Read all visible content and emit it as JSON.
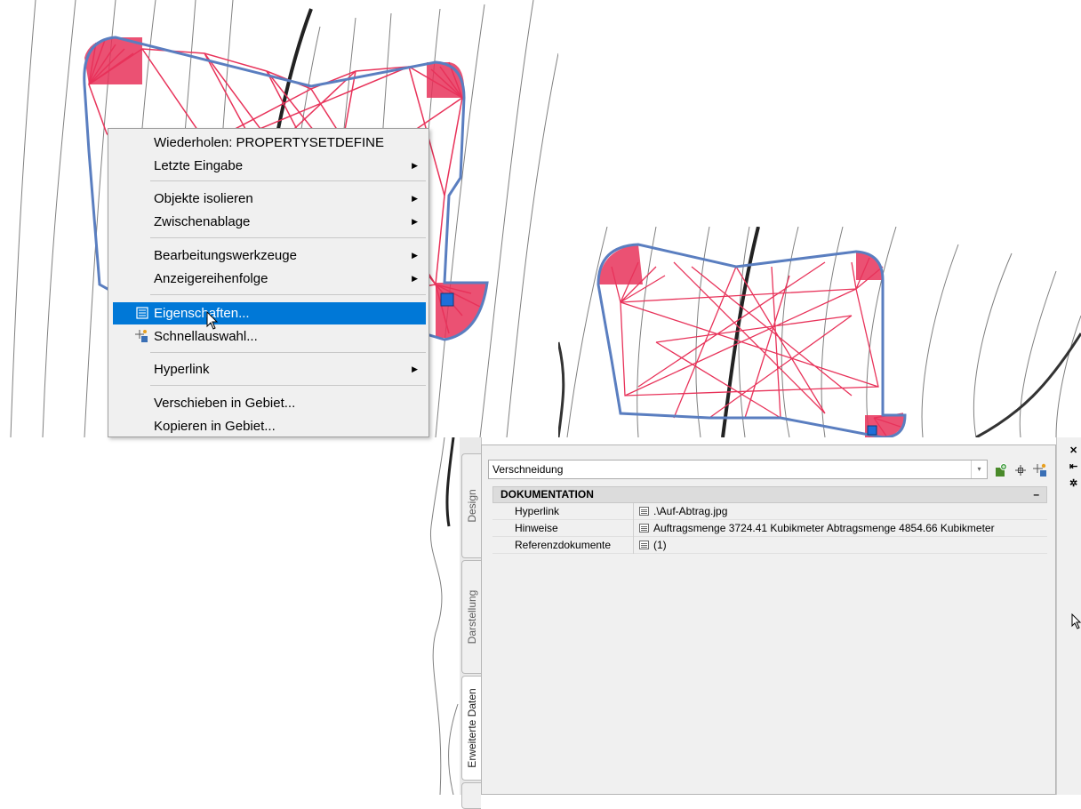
{
  "context_menu": {
    "items": [
      {
        "label": "Wiederholen: PROPERTYSETDEFINE",
        "submenu": false
      },
      {
        "label": "Letzte Eingabe",
        "submenu": true
      },
      {
        "label": "Objekte isolieren",
        "submenu": true
      },
      {
        "label": "Zwischenablage",
        "submenu": true
      },
      {
        "label": "Bearbeitungswerkzeuge",
        "submenu": true
      },
      {
        "label": "Anzeigereihenfolge",
        "submenu": true
      },
      {
        "label": "Eigenschaften...",
        "submenu": false,
        "selected": true,
        "icon": "properties-icon"
      },
      {
        "label": "Schnellauswahl...",
        "submenu": false,
        "icon": "quick-select-icon"
      },
      {
        "label": "Hyperlink",
        "submenu": true
      },
      {
        "label": "Verschieben in Gebiet...",
        "submenu": false
      },
      {
        "label": "Kopieren in Gebiet...",
        "submenu": false
      }
    ],
    "submenu_arrow": "▶"
  },
  "properties_palette": {
    "object_type": "Verschneidung",
    "dropdown_glyph": "▾",
    "tabs": [
      {
        "label": "Design",
        "active": false
      },
      {
        "label": "Darstellung",
        "active": false
      },
      {
        "label": "Erweiterte Daten",
        "active": true
      }
    ],
    "section": {
      "title": "DOKUMENTATION",
      "collapse_glyph": "–"
    },
    "rows": [
      {
        "label": "Hyperlink",
        "value": ".\\Auf-Abtrag.jpg"
      },
      {
        "label": "Hinweise",
        "value": "Auftragsmenge  3724.41 Kubikmeter Abtragsmenge  4854.66 Kubikmeter"
      },
      {
        "label": "Referenzdokumente",
        "value": "(1)"
      }
    ],
    "sidebar_buttons": [
      "close-icon",
      "auto-hide-icon",
      "settings-icon"
    ],
    "sidebar_glyphs": {
      "close": "✕",
      "autohide": "⇤",
      "settings": "✲"
    }
  },
  "colors": {
    "menu_highlight": "#0078d7",
    "grading_outline": "#5a7ec0",
    "grading_lines": "#e8335a",
    "contour": "#808080",
    "grip": "#1e6fd9"
  }
}
